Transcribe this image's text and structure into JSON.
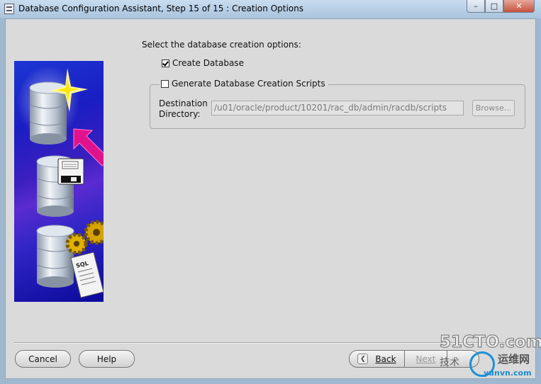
{
  "window": {
    "title": "Database Configuration Assistant, Step 15 of 15 : Creation Options",
    "app_icon": "dbca-app-icon",
    "controls": {
      "minimize": "–",
      "maximize": "□",
      "close": "✕"
    }
  },
  "illustration": {
    "sql_label": "SQL"
  },
  "content": {
    "prompt": "Select the database creation options:",
    "create_database": {
      "label": "Create Database",
      "checked": true
    },
    "generate_scripts": {
      "label": "Generate Database Creation Scripts",
      "checked": false
    },
    "destination": {
      "label_line1": "Destination",
      "label_line2": "Directory:",
      "value": "/u01/oracle/product/10201/rac_db/admin/racdb/scripts",
      "browse_label": "Browse..."
    }
  },
  "footer": {
    "cancel": "Cancel",
    "help": "Help",
    "back": "Back",
    "next": "Next",
    "finish": ""
  },
  "watermark": {
    "top": "51CTO.com",
    "left": "技术",
    "right": "运维网",
    "url": "yunvn.com"
  }
}
